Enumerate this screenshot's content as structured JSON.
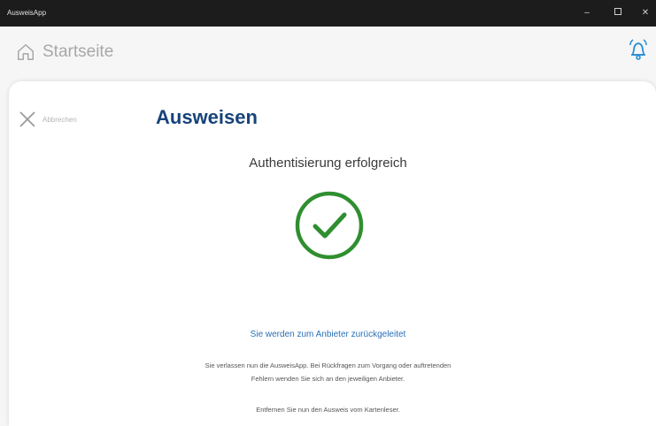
{
  "window": {
    "title": "AusweisApp",
    "minimize": "–",
    "close": "✕"
  },
  "nav": {
    "home_label": "Startseite",
    "home_icon": "home-icon",
    "bell_icon": "bell-icon"
  },
  "abort": {
    "label": "Abbrechen",
    "icon": "close-icon"
  },
  "main": {
    "title": "Ausweisen",
    "status": "Authentisierung erfolgreich",
    "success_icon": "checkmark-circle-icon",
    "redirect": "Sie werden zum Anbieter zurückgeleitet",
    "info_line1": "Sie verlassen nun die AusweisApp. Bei Rückfragen zum Vorgang oder auftretenden",
    "info_line2": "Fehlern wenden Sie sich an den jeweiligen Anbieter.",
    "remove_card": "Entfernen Sie nun den Ausweis vom Kartenleser."
  },
  "colors": {
    "accent": "#17437a",
    "success": "#2f8f2f",
    "link": "#2a6fb8",
    "bell": "#2a8fd6"
  }
}
